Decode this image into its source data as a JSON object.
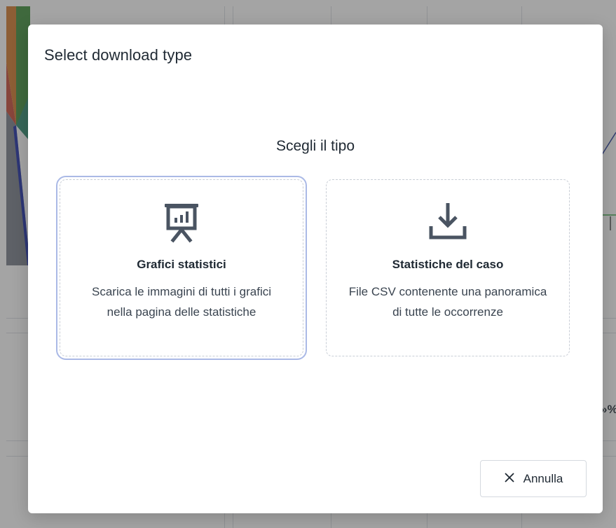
{
  "background": {
    "percent_fragment": "»%"
  },
  "modal": {
    "title": "Select download type",
    "heading": "Scegli il tipo",
    "options": [
      {
        "icon": "presentation-chart-icon",
        "title": "Grafici statistici",
        "description": "Scarica le immagini di tutti i grafici nella pagina delle statistiche",
        "selected": true
      },
      {
        "icon": "download-icon",
        "title": "Statistiche del caso",
        "description": "File CSV contenente una panoramica di tutte le occorrenze",
        "selected": false
      }
    ],
    "cancel_label": "Annulla",
    "cancel_icon": "close-icon"
  },
  "colors": {
    "overlay": "#404040",
    "selected_outline": "#aab9e6",
    "icon": "#4a5462",
    "text": "#1f2933"
  }
}
